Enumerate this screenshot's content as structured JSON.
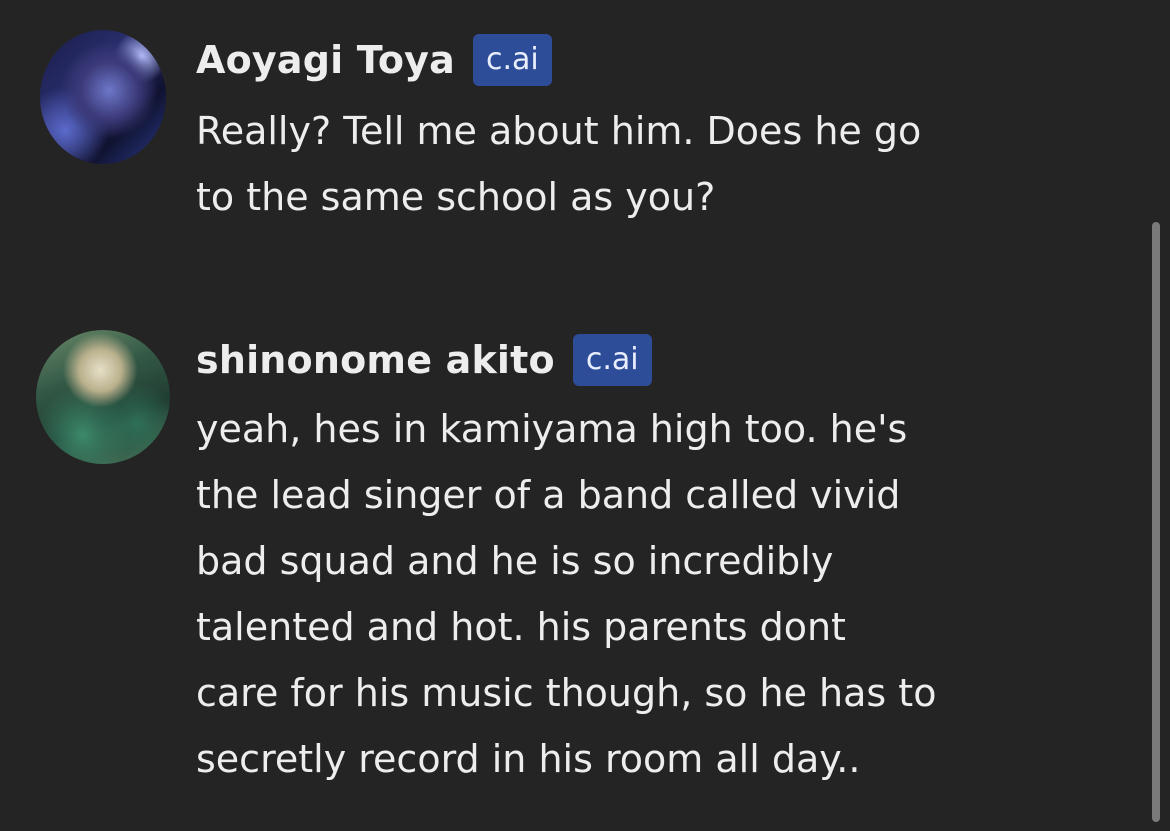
{
  "messages": [
    {
      "author": "Aoyagi Toya",
      "badge": "c.ai",
      "text": "Really? Tell me about him. Does he go\nto the same school as you?"
    },
    {
      "author": "shinonome akito",
      "badge": "c.ai",
      "text": "yeah, hes in kamiyama high too. he's\nthe lead singer of a band called vivid\nbad squad and he is so incredibly\ntalented and hot. his parents dont\ncare for his music though, so he has to\nsecretly record in his room all day.."
    }
  ],
  "colors": {
    "background": "#242424",
    "text": "#ededed",
    "badge_background": "#2e4d99"
  }
}
